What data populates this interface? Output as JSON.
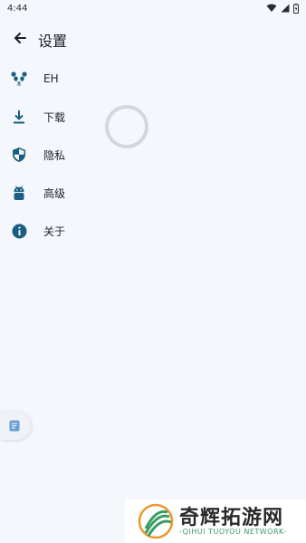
{
  "status_bar": {
    "time": "4:44"
  },
  "app_bar": {
    "title": "设置"
  },
  "menu": {
    "items": [
      {
        "label": "EH",
        "icon": "panda-icon"
      },
      {
        "label": "下载",
        "icon": "download-icon"
      },
      {
        "label": "隐私",
        "icon": "shield-icon"
      },
      {
        "label": "高级",
        "icon": "android-icon"
      },
      {
        "label": "关于",
        "icon": "info-icon"
      }
    ]
  },
  "colors": {
    "accent": "#1a5f82",
    "background": "#f4f8fc",
    "spinner": "#d3d8dd",
    "fab_icon": "#6a9fd8",
    "watermark_green": "#3a9d64",
    "watermark_orange": "#e89a2a"
  },
  "watermark": {
    "title": "奇辉拓游网",
    "subtitle": "-QIHUI TUOYOU NETWORK-"
  }
}
